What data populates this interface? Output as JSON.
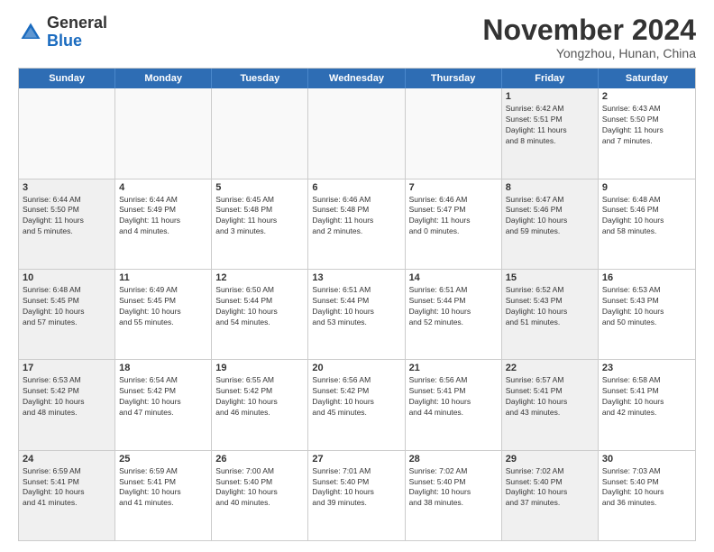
{
  "logo": {
    "general": "General",
    "blue": "Blue"
  },
  "title": "November 2024",
  "subtitle": "Yongzhou, Hunan, China",
  "header_days": [
    "Sunday",
    "Monday",
    "Tuesday",
    "Wednesday",
    "Thursday",
    "Friday",
    "Saturday"
  ],
  "weeks": [
    [
      {
        "day": "",
        "info": "",
        "empty": true
      },
      {
        "day": "",
        "info": "",
        "empty": true
      },
      {
        "day": "",
        "info": "",
        "empty": true
      },
      {
        "day": "",
        "info": "",
        "empty": true
      },
      {
        "day": "",
        "info": "",
        "empty": true
      },
      {
        "day": "1",
        "info": "Sunrise: 6:42 AM\nSunset: 5:51 PM\nDaylight: 11 hours\nand 8 minutes.",
        "shaded": true
      },
      {
        "day": "2",
        "info": "Sunrise: 6:43 AM\nSunset: 5:50 PM\nDaylight: 11 hours\nand 7 minutes.",
        "shaded": false
      }
    ],
    [
      {
        "day": "3",
        "info": "Sunrise: 6:44 AM\nSunset: 5:50 PM\nDaylight: 11 hours\nand 5 minutes.",
        "shaded": true
      },
      {
        "day": "4",
        "info": "Sunrise: 6:44 AM\nSunset: 5:49 PM\nDaylight: 11 hours\nand 4 minutes.",
        "shaded": false
      },
      {
        "day": "5",
        "info": "Sunrise: 6:45 AM\nSunset: 5:48 PM\nDaylight: 11 hours\nand 3 minutes.",
        "shaded": false
      },
      {
        "day": "6",
        "info": "Sunrise: 6:46 AM\nSunset: 5:48 PM\nDaylight: 11 hours\nand 2 minutes.",
        "shaded": false
      },
      {
        "day": "7",
        "info": "Sunrise: 6:46 AM\nSunset: 5:47 PM\nDaylight: 11 hours\nand 0 minutes.",
        "shaded": false
      },
      {
        "day": "8",
        "info": "Sunrise: 6:47 AM\nSunset: 5:46 PM\nDaylight: 10 hours\nand 59 minutes.",
        "shaded": true
      },
      {
        "day": "9",
        "info": "Sunrise: 6:48 AM\nSunset: 5:46 PM\nDaylight: 10 hours\nand 58 minutes.",
        "shaded": false
      }
    ],
    [
      {
        "day": "10",
        "info": "Sunrise: 6:48 AM\nSunset: 5:45 PM\nDaylight: 10 hours\nand 57 minutes.",
        "shaded": true
      },
      {
        "day": "11",
        "info": "Sunrise: 6:49 AM\nSunset: 5:45 PM\nDaylight: 10 hours\nand 55 minutes.",
        "shaded": false
      },
      {
        "day": "12",
        "info": "Sunrise: 6:50 AM\nSunset: 5:44 PM\nDaylight: 10 hours\nand 54 minutes.",
        "shaded": false
      },
      {
        "day": "13",
        "info": "Sunrise: 6:51 AM\nSunset: 5:44 PM\nDaylight: 10 hours\nand 53 minutes.",
        "shaded": false
      },
      {
        "day": "14",
        "info": "Sunrise: 6:51 AM\nSunset: 5:44 PM\nDaylight: 10 hours\nand 52 minutes.",
        "shaded": false
      },
      {
        "day": "15",
        "info": "Sunrise: 6:52 AM\nSunset: 5:43 PM\nDaylight: 10 hours\nand 51 minutes.",
        "shaded": true
      },
      {
        "day": "16",
        "info": "Sunrise: 6:53 AM\nSunset: 5:43 PM\nDaylight: 10 hours\nand 50 minutes.",
        "shaded": false
      }
    ],
    [
      {
        "day": "17",
        "info": "Sunrise: 6:53 AM\nSunset: 5:42 PM\nDaylight: 10 hours\nand 48 minutes.",
        "shaded": true
      },
      {
        "day": "18",
        "info": "Sunrise: 6:54 AM\nSunset: 5:42 PM\nDaylight: 10 hours\nand 47 minutes.",
        "shaded": false
      },
      {
        "day": "19",
        "info": "Sunrise: 6:55 AM\nSunset: 5:42 PM\nDaylight: 10 hours\nand 46 minutes.",
        "shaded": false
      },
      {
        "day": "20",
        "info": "Sunrise: 6:56 AM\nSunset: 5:42 PM\nDaylight: 10 hours\nand 45 minutes.",
        "shaded": false
      },
      {
        "day": "21",
        "info": "Sunrise: 6:56 AM\nSunset: 5:41 PM\nDaylight: 10 hours\nand 44 minutes.",
        "shaded": false
      },
      {
        "day": "22",
        "info": "Sunrise: 6:57 AM\nSunset: 5:41 PM\nDaylight: 10 hours\nand 43 minutes.",
        "shaded": true
      },
      {
        "day": "23",
        "info": "Sunrise: 6:58 AM\nSunset: 5:41 PM\nDaylight: 10 hours\nand 42 minutes.",
        "shaded": false
      }
    ],
    [
      {
        "day": "24",
        "info": "Sunrise: 6:59 AM\nSunset: 5:41 PM\nDaylight: 10 hours\nand 41 minutes.",
        "shaded": true
      },
      {
        "day": "25",
        "info": "Sunrise: 6:59 AM\nSunset: 5:41 PM\nDaylight: 10 hours\nand 41 minutes.",
        "shaded": false
      },
      {
        "day": "26",
        "info": "Sunrise: 7:00 AM\nSunset: 5:40 PM\nDaylight: 10 hours\nand 40 minutes.",
        "shaded": false
      },
      {
        "day": "27",
        "info": "Sunrise: 7:01 AM\nSunset: 5:40 PM\nDaylight: 10 hours\nand 39 minutes.",
        "shaded": false
      },
      {
        "day": "28",
        "info": "Sunrise: 7:02 AM\nSunset: 5:40 PM\nDaylight: 10 hours\nand 38 minutes.",
        "shaded": false
      },
      {
        "day": "29",
        "info": "Sunrise: 7:02 AM\nSunset: 5:40 PM\nDaylight: 10 hours\nand 37 minutes.",
        "shaded": true
      },
      {
        "day": "30",
        "info": "Sunrise: 7:03 AM\nSunset: 5:40 PM\nDaylight: 10 hours\nand 36 minutes.",
        "shaded": false
      }
    ]
  ]
}
